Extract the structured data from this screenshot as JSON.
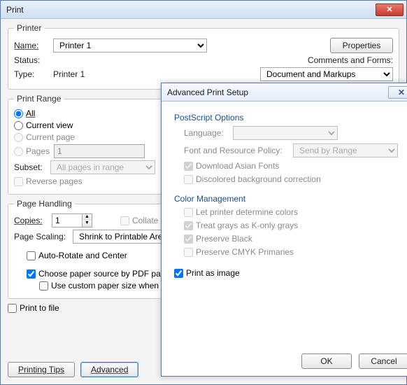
{
  "print": {
    "title": "Print",
    "printer_legend": "Printer",
    "name_label": "Name:",
    "name_value": "Printer 1",
    "properties_btn": "Properties",
    "status_label": "Status:",
    "type_label": "Type:",
    "type_value": "Printer 1",
    "comments_label": "Comments and Forms:",
    "comments_value": "Document and Markups",
    "range_legend": "Print Range",
    "r_all": "All",
    "r_current_view": "Current view",
    "r_current_page": "Current page",
    "r_pages": "Pages",
    "pages_value": "1",
    "subset_label": "Subset:",
    "subset_value": "All pages in range",
    "reverse_pages": "Reverse pages",
    "handling_legend": "Page Handling",
    "copies_label": "Copies:",
    "copies_value": "1",
    "collate": "Collate",
    "scaling_label": "Page Scaling:",
    "scaling_value": "Shrink to Printable Area",
    "auto_rotate": "Auto-Rotate and Center",
    "choose_paper": "Choose paper source by PDF page size",
    "custom_paper": "Use custom paper size when needed",
    "print_to_file": "Print to file",
    "tips_btn": "Printing Tips",
    "advanced_btn": "Advanced"
  },
  "adv": {
    "title": "Advanced Print Setup",
    "ps_title": "PostScript Options",
    "language_label": "Language:",
    "font_policy_label": "Font and Resource Policy:",
    "font_policy_value": "Send by Range",
    "dl_asian": "Download Asian Fonts",
    "discolored": "Discolored background correction",
    "cm_title": "Color Management",
    "let_printer": "Let printer determine colors",
    "konly": "Treat grays as K-only grays",
    "preserve_black": "Preserve Black",
    "preserve_cmyk": "Preserve CMYK Primaries",
    "print_as_image": "Print as image",
    "ok": "OK",
    "cancel": "Cancel"
  }
}
